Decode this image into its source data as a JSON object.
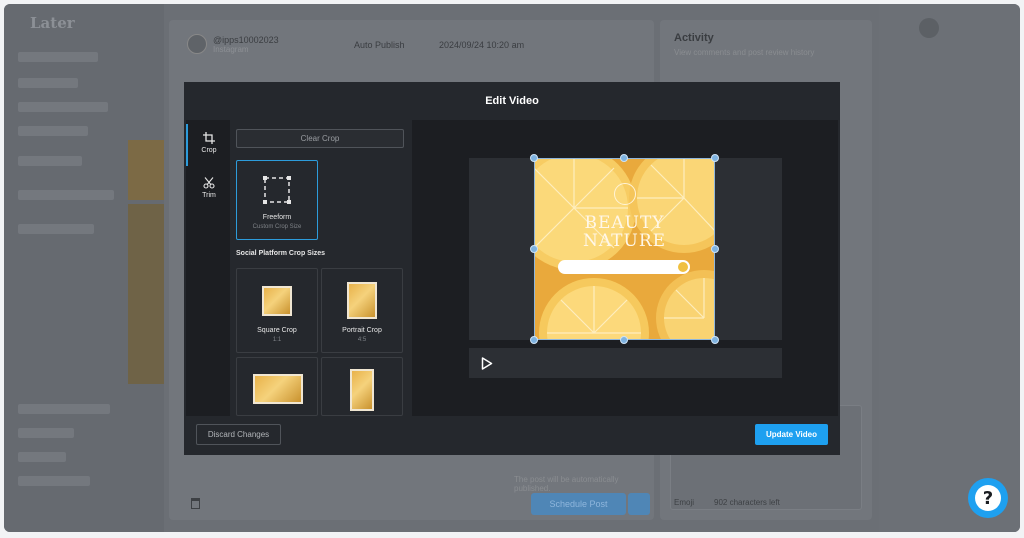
{
  "background": {
    "logo": "Later",
    "account": {
      "handle": "@ipps10002023",
      "platform": "Instagram"
    },
    "toolbar": {
      "publish_mode": "Auto Publish",
      "date_time": "2024/09/24 10:20 am"
    },
    "footer_note": "The post will be automatically published.",
    "schedule_button": "Schedule Post",
    "activity": {
      "title": "Activity",
      "subtitle": "View comments and post review history",
      "emoji_label": "Emoji",
      "chars_left": "902 characters left"
    }
  },
  "modal": {
    "title": "Edit Video",
    "tools": [
      {
        "label": "Crop",
        "icon": "crop-icon",
        "active": true
      },
      {
        "label": "Trim",
        "icon": "scissors-icon",
        "active": false
      }
    ],
    "clear_crop_label": "Clear Crop",
    "freeform": {
      "label": "Freeform",
      "sub": "Custom Crop Size"
    },
    "social_sizes_label": "Social Platform Crop Sizes",
    "crop_sizes": [
      {
        "label": "Square Crop",
        "ratio": "1:1"
      },
      {
        "label": "Portrait Crop",
        "ratio": "4:5"
      },
      {
        "label": "",
        "ratio": ""
      },
      {
        "label": "",
        "ratio": ""
      }
    ],
    "preview": {
      "line1": "BEAUTY",
      "line2": "NATURE"
    },
    "discard_label": "Discard Changes",
    "update_label": "Update Video"
  },
  "help": {
    "glyph": "?"
  },
  "colors": {
    "accent": "#1ea0f0",
    "modal_bg": "#25282d",
    "panel_bg": "#1c1e22"
  }
}
